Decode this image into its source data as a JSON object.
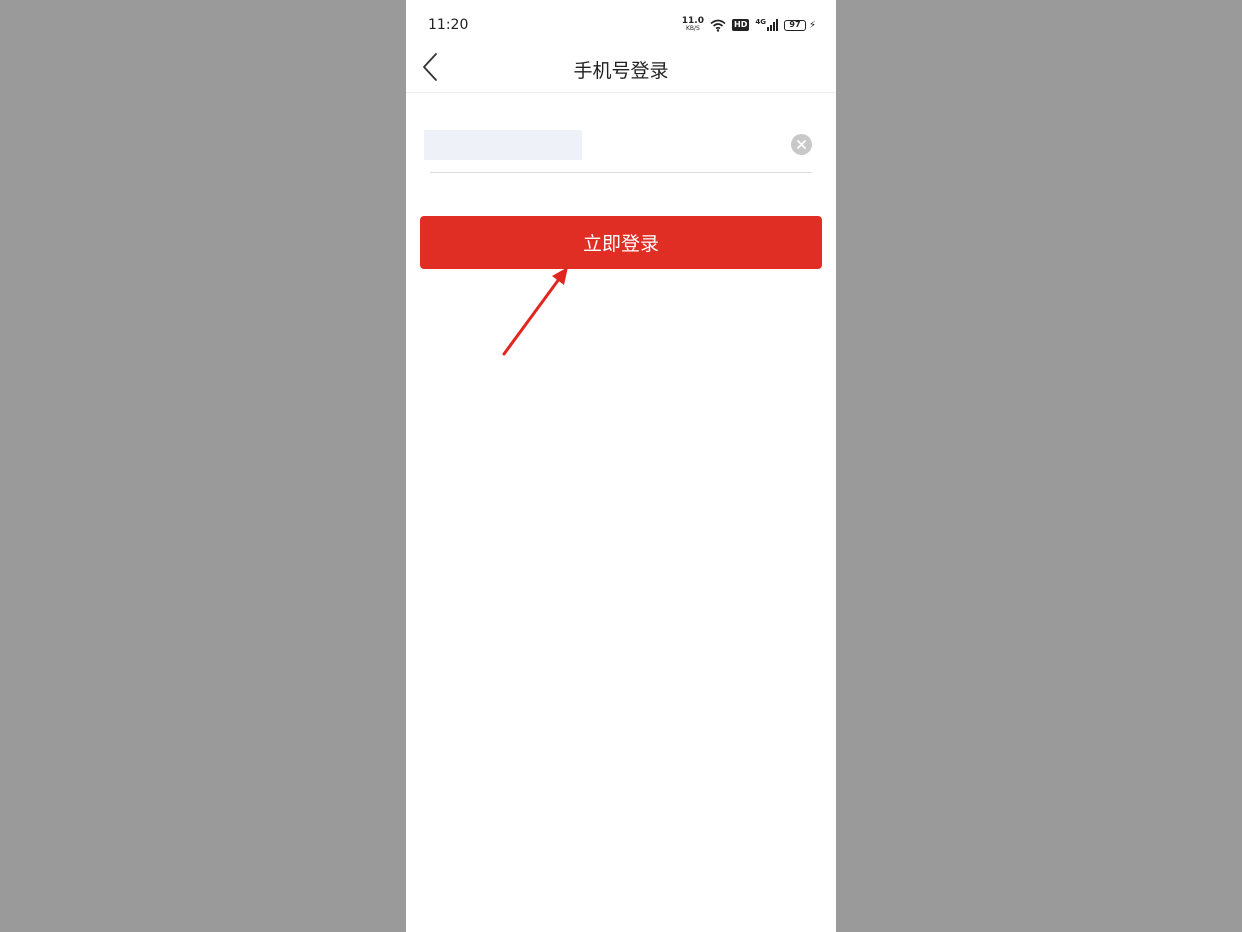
{
  "status_bar": {
    "time": "11:20",
    "net_speed_value": "11.0",
    "net_speed_unit": "KB/S",
    "hd_label": "HD",
    "signal_label": "4G",
    "battery_level": "97",
    "icons": [
      "wifi-icon",
      "hd-icon",
      "signal-icon",
      "battery-icon",
      "charging-bolt-icon"
    ]
  },
  "nav": {
    "title": "手机号登录",
    "back_icon": "chevron-left-icon"
  },
  "form": {
    "phone_value": "",
    "clear_icon": "clear-circle-icon"
  },
  "login_button": {
    "label": "立即登录",
    "color": "#e02e24"
  },
  "annotation": {
    "arrow_icon": "red-arrow-icon",
    "color": "#e0271f"
  }
}
